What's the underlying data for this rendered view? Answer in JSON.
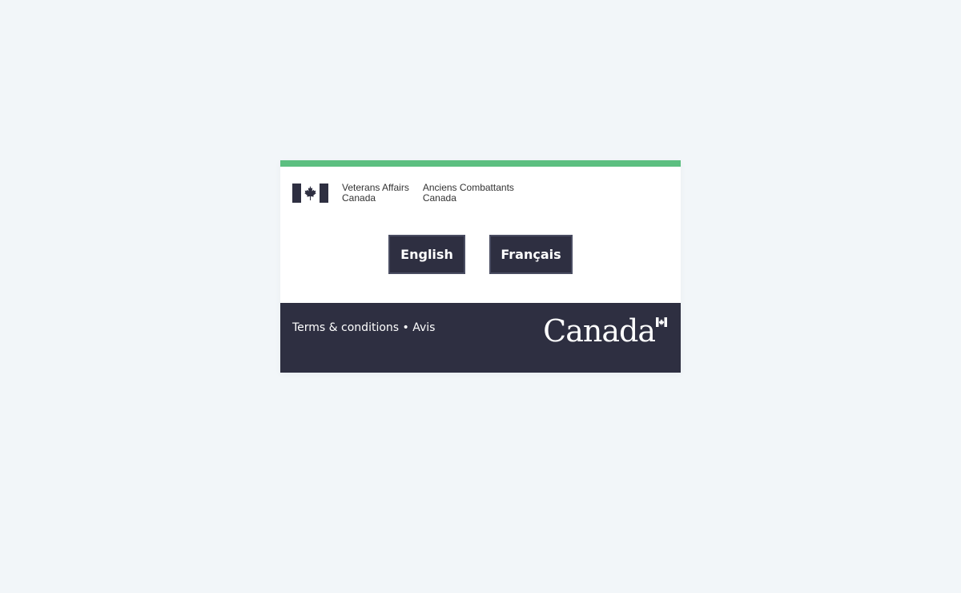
{
  "colors": {
    "page_background": "#f2f6f9",
    "accent": "#5cbf80",
    "dark": "#2e2f41",
    "button_border": "#4a4d62"
  },
  "header": {
    "flag_icon": "canada-flag-icon",
    "signature_en": {
      "line1": "Veterans Affairs",
      "line2": "Canada"
    },
    "signature_fr": {
      "line1": "Anciens Combattants",
      "line2": "Canada"
    }
  },
  "language_buttons": {
    "english_label": "English",
    "french_label": "Français"
  },
  "footer": {
    "terms_label": "Terms & conditions",
    "separator": " • ",
    "avis_label": "Avis",
    "wordmark": "Canada",
    "wordmark_flag_icon": "canada-wordmark-flag-icon"
  }
}
